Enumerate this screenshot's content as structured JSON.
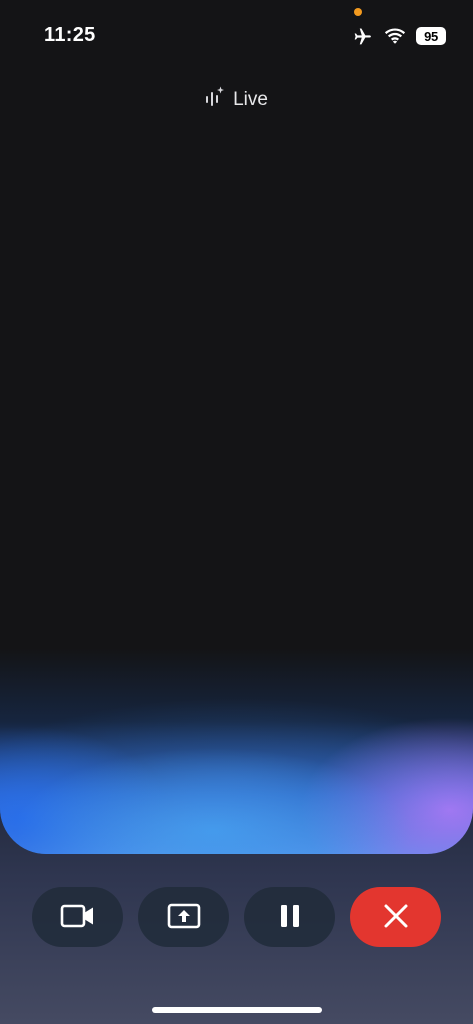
{
  "status_bar": {
    "time": "11:25",
    "battery": "95",
    "icons": [
      "airplane-icon",
      "wifi-icon",
      "battery-icon"
    ],
    "indicator_color": "#f39a1f"
  },
  "header": {
    "title": "Live",
    "icon": "live-sparkle-icon"
  },
  "controls": [
    {
      "name": "camera-button",
      "icon": "video-camera-icon"
    },
    {
      "name": "share-screen-button",
      "icon": "screen-share-icon"
    },
    {
      "name": "pause-button",
      "icon": "pause-icon"
    },
    {
      "name": "end-button",
      "icon": "close-icon",
      "color": "#e3362f"
    }
  ]
}
